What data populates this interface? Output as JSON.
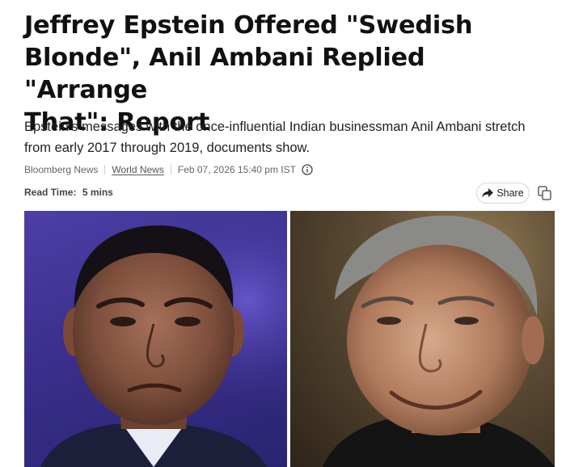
{
  "article": {
    "headline_line1": "Jeffrey Epstein Offered \"Swedish",
    "headline_line2": "Blonde\", Anil Ambani Replied \"Arrange",
    "headline_line3": "That\": Report",
    "subhead_line1": "Epstein's messages with the once-influential Indian businessman Anil Ambani stretch",
    "subhead_line2": "from early 2017 through 2019, documents show.",
    "source": "Bloomberg News",
    "category": "World News",
    "timestamp": "Feb 07, 2026 15:40 pm IST",
    "read_time_label": "Read Time:",
    "read_time_value": "5 mins",
    "share_label": "Share"
  },
  "icons": {
    "info": "info-icon",
    "share": "share-arrow-icon",
    "copy": "copy-icon"
  },
  "colors": {
    "left_photo_bg": "#3a2f8c",
    "right_photo_bg": "#6e5a3e"
  }
}
